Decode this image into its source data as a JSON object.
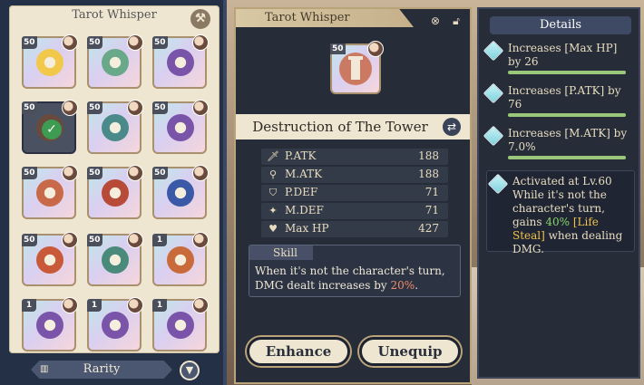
{
  "left": {
    "title": "Tarot Whisper",
    "filter_icon": "hammer-icon",
    "cards": [
      {
        "level": "50",
        "emblem": "sun",
        "color": "#f2c84b"
      },
      {
        "level": "50",
        "emblem": "tower",
        "color": "#6aa88a"
      },
      {
        "level": "50",
        "emblem": "moon",
        "color": "#7a54a8"
      },
      {
        "level": "50",
        "emblem": "tower",
        "color": "#6a4a3c",
        "selected": true
      },
      {
        "level": "50",
        "emblem": "lovers",
        "color": "#4a8a8a"
      },
      {
        "level": "50",
        "emblem": "moon",
        "color": "#7a54a8"
      },
      {
        "level": "50",
        "emblem": "tower",
        "color": "#c86a4a"
      },
      {
        "level": "50",
        "emblem": "crown",
        "color": "#b84a3a"
      },
      {
        "level": "50",
        "emblem": "scales",
        "color": "#3a5aa8"
      },
      {
        "level": "50",
        "emblem": "wheel",
        "color": "#c85a3a"
      },
      {
        "level": "50",
        "emblem": "sun",
        "color": "#4a8a7a"
      },
      {
        "level": "1",
        "emblem": "crown",
        "color": "#c86a3a"
      },
      {
        "level": "1",
        "emblem": "moon",
        "color": "#7a54a8"
      },
      {
        "level": "1",
        "emblem": "moon",
        "color": "#7a54a8"
      },
      {
        "level": "1",
        "emblem": "moon",
        "color": "#7a54a8"
      }
    ],
    "rarity_label": "Rarity",
    "sort_icon": "filter-icon"
  },
  "middle": {
    "title": "Tarot Whisper",
    "card_level": "50",
    "card_name": "Destruction of The Tower",
    "stats": [
      {
        "label": "P.ATK",
        "value": "188",
        "icon": "sword-icon"
      },
      {
        "label": "M.ATK",
        "value": "188",
        "icon": "wand-icon"
      },
      {
        "label": "P.DEF",
        "value": "71",
        "icon": "shield-icon"
      },
      {
        "label": "M.DEF",
        "value": "71",
        "icon": "magic-shield-icon"
      },
      {
        "label": "Max HP",
        "value": "427",
        "icon": "heart-icon"
      }
    ],
    "skill_label": "Skill",
    "skill_text_1": "When it's not the character's turn, DMG dealt increases by ",
    "skill_value": "20%",
    "skill_text_2": ".",
    "enhance_label": "Enhance",
    "unequip_label": "Unequip"
  },
  "right": {
    "title": "Details",
    "details": [
      {
        "text": "Increases [Max HP] by 26",
        "progress": 1.0
      },
      {
        "text": "Increases [P.ATK] by 76",
        "progress": 1.0
      },
      {
        "text": "Increases [M.ATK] by 7.0%",
        "progress": 1.0
      }
    ],
    "activated_title": "Activated at Lv.60",
    "activated_text_1": "While it's not the character's turn, gains ",
    "activated_value": "40%",
    "activated_tag": "[Life Steal]",
    "activated_text_2": " when dealing DMG."
  },
  "colors": {
    "accent_gold": "#b9a47a",
    "highlight_red": "#f08a6a",
    "highlight_green": "#8ad46a",
    "highlight_yellow": "#f0c24a"
  }
}
